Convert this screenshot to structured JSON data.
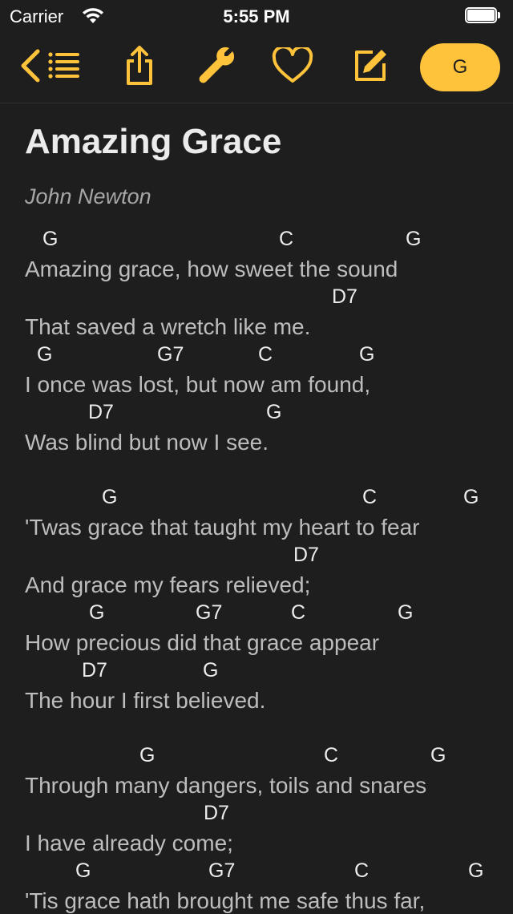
{
  "status_bar": {
    "carrier": "Carrier",
    "time": "5:55 PM",
    "wifi_icon": "wifi-icon",
    "battery_icon": "battery-icon"
  },
  "toolbar": {
    "accent_color": "#fec33b",
    "back_icon": "back-list-icon",
    "share_icon": "share-icon",
    "tools_icon": "wrench-icon",
    "favorite_icon": "heart-icon",
    "edit_icon": "edit-icon",
    "key_label": "G"
  },
  "song": {
    "title": "Amazing Grace",
    "author": "John Newton",
    "verses": [
      {
        "lines": [
          {
            "chords": [
              "G",
              "C",
              "G"
            ],
            "lyric": "Amazing grace, how sweet the sound"
          },
          {
            "chords": [
              "D7"
            ],
            "lyric": "That saved a wretch like me."
          },
          {
            "chords": [
              "G",
              "G7",
              "C",
              "G"
            ],
            "lyric": "I once was lost, but now am found,"
          },
          {
            "chords": [
              "D7",
              "G"
            ],
            "lyric": "Was blind but now I see."
          }
        ]
      },
      {
        "lines": [
          {
            "chords": [
              "G",
              "C",
              "G"
            ],
            "lyric": "'Twas grace that taught my heart to fear"
          },
          {
            "chords": [
              "D7"
            ],
            "lyric": "And grace my fears relieved;"
          },
          {
            "chords": [
              "G",
              "G7",
              "C",
              "G"
            ],
            "lyric": "How precious did that grace appear"
          },
          {
            "chords": [
              "D7",
              "G"
            ],
            "lyric": "The hour I first believed."
          }
        ]
      },
      {
        "lines": [
          {
            "chords": [
              "G",
              "C",
              "G"
            ],
            "lyric": "Through many dangers, toils and snares"
          },
          {
            "chords": [
              "D7"
            ],
            "lyric": "I have already come;"
          },
          {
            "chords": [
              "G",
              "G7",
              "C",
              "G"
            ],
            "lyric": "'Tis grace hath brought me safe thus far,"
          }
        ]
      }
    ]
  }
}
